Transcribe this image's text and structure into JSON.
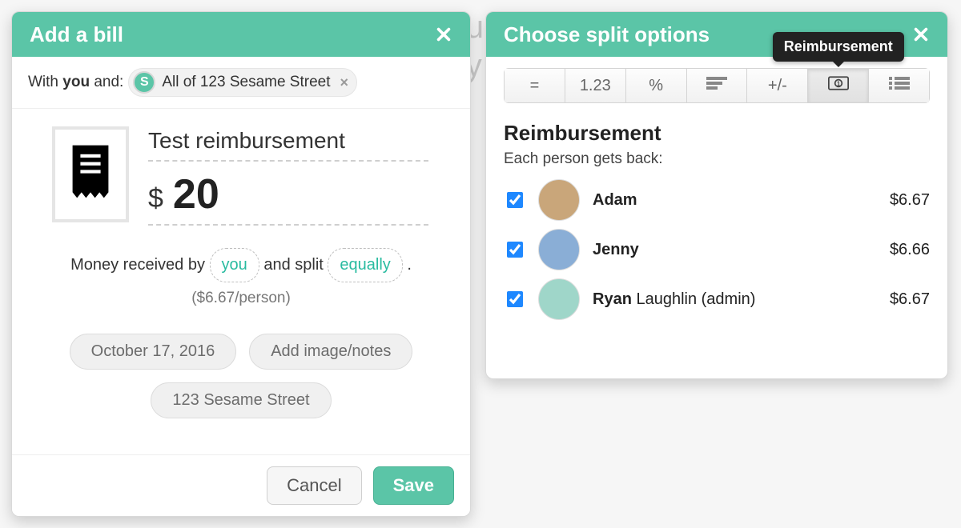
{
  "add_bill": {
    "title": "Add a bill",
    "with_prefix": "With ",
    "with_you": "you",
    "with_suffix": " and:",
    "chip_label": "All of 123 Sesame Street",
    "chip_badge": "S",
    "description": "Test reimbursement",
    "currency_symbol": "$",
    "amount": "20",
    "sentence_pre": "Money received by ",
    "payer_label": "you",
    "sentence_mid": " and split ",
    "split_label": "equally",
    "sentence_end": ".",
    "per_person": "($6.67/person)",
    "date_label": "October 17, 2016",
    "notes_label": "Add image/notes",
    "group_label": "123 Sesame Street",
    "cancel_label": "Cancel",
    "save_label": "Save"
  },
  "split": {
    "title": "Choose split options",
    "tooltip": "Reimbursement",
    "seg_options": {
      "equal": "=",
      "exact": "1.23",
      "percent": "%",
      "plusminus": "+/-"
    },
    "section_title": "Reimbursement",
    "section_sub": "Each person gets back:",
    "people": [
      {
        "name_bold": "Adam",
        "name_rest": "",
        "amount": "$6.67",
        "checked": true
      },
      {
        "name_bold": "Jenny",
        "name_rest": "",
        "amount": "$6.66",
        "checked": true
      },
      {
        "name_bold": "Ryan",
        "name_rest": " Laughlin (admin)",
        "amount": "$6.67",
        "checked": true
      }
    ]
  }
}
